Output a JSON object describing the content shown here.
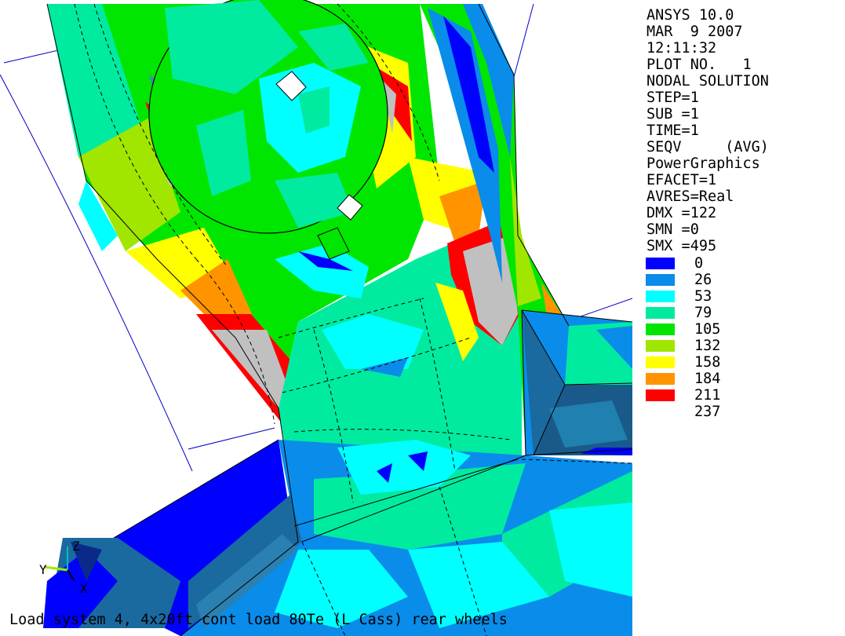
{
  "info": {
    "lines": [
      "ANSYS 10.0",
      "MAR  9 2007",
      "12:11:32",
      "PLOT NO.   1",
      "NODAL SOLUTION",
      "STEP=1",
      "SUB =1",
      "TIME=1",
      "SEQV     (AVG)",
      "PowerGraphics",
      "EFACET=1",
      "AVRES=Real",
      "DMX =122",
      "SMN =0",
      "SMX =495"
    ]
  },
  "legend": {
    "entries": [
      {
        "value": "0",
        "color": "#0000ff"
      },
      {
        "value": "26",
        "color": "#0a8cea"
      },
      {
        "value": "53",
        "color": "#00ffff"
      },
      {
        "value": "79",
        "color": "#00eba0"
      },
      {
        "value": "105",
        "color": "#00e600"
      },
      {
        "value": "132",
        "color": "#a0e600"
      },
      {
        "value": "158",
        "color": "#ffff00"
      },
      {
        "value": "184",
        "color": "#ff9400"
      },
      {
        "value": "211",
        "color": "#ff0000"
      },
      {
        "value": "237",
        "color": ""
      }
    ]
  },
  "footer": {
    "caption": "Load system 4, 4x20ft cont load 80Te (L Cass) rear wheels"
  },
  "triad": {
    "y_label": "Y",
    "z_label": "Z",
    "x_label": "X"
  },
  "colors": {
    "max_band": "#c0c0c0",
    "wire": "#0000c8"
  }
}
